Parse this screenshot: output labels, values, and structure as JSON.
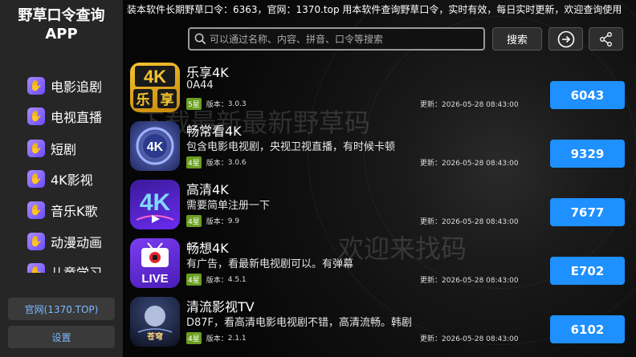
{
  "app": {
    "title_line1": "野草口令查询",
    "title_line2": "APP"
  },
  "sidebar": {
    "items": [
      {
        "label": "电影追剧"
      },
      {
        "label": "电视直播"
      },
      {
        "label": "短剧"
      },
      {
        "label": "4K影视"
      },
      {
        "label": "音乐K歌"
      },
      {
        "label": "动漫动画"
      },
      {
        "label": "儿童学习"
      }
    ],
    "official_site_label": "官网(1370.TOP)",
    "settings_label": "设置"
  },
  "header": {
    "marquee": "装本软件长期野草口令：6363，官网：1370.top 用本软件查询野草口令，实时有效，每日实时更新，欢迎查询使用",
    "search_placeholder": "可以通过名称、内容、拼音、口令等搜索",
    "search_button": "搜索"
  },
  "watermarks": [
    "下载最新最新野草码",
    "欢迎来找码"
  ],
  "meta_labels": {
    "version": "版本：",
    "updated": "更新："
  },
  "apps": [
    {
      "name": "乐享4K",
      "desc": "0A44",
      "stars": "5星",
      "version": "3.0.3",
      "updated": "2026-05-28 08:43:00",
      "code": "6043",
      "logo_text": "4K乐享",
      "logo_color": "#e8a818"
    },
    {
      "name": "畅常看4K",
      "desc": "包含电影电视剧，央视卫视直播，有时候卡顿",
      "stars": "4星",
      "version": "3.0.6",
      "updated": "2026-05-28 08:43:00",
      "code": "9329",
      "logo_text": "4K",
      "logo_color": "#3d5aa8"
    },
    {
      "name": "高清4K",
      "desc": "需要简单注册一下",
      "stars": "4星",
      "version": "9.9",
      "updated": "2026-05-28 08:43:00",
      "code": "7677",
      "logo_text": "4K",
      "logo_color": "#5a2cc8"
    },
    {
      "name": "畅想4K",
      "desc": "有广告，看最新电视剧可以。有弹幕",
      "stars": "4星",
      "version": "4.5.1",
      "updated": "2026-05-28 08:43:00",
      "code": "E702",
      "logo_text": "LIVE",
      "logo_color": "#6a2fd0"
    },
    {
      "name": "清流影视TV",
      "desc": "D87F，看高清电影电视剧不错，高清流畅。韩剧",
      "stars": "4星",
      "version": "2.1.1",
      "updated": "2026-05-28 08:43:00",
      "code": "6102",
      "logo_text": "苍穹",
      "logo_color": "#1c2238"
    }
  ]
}
